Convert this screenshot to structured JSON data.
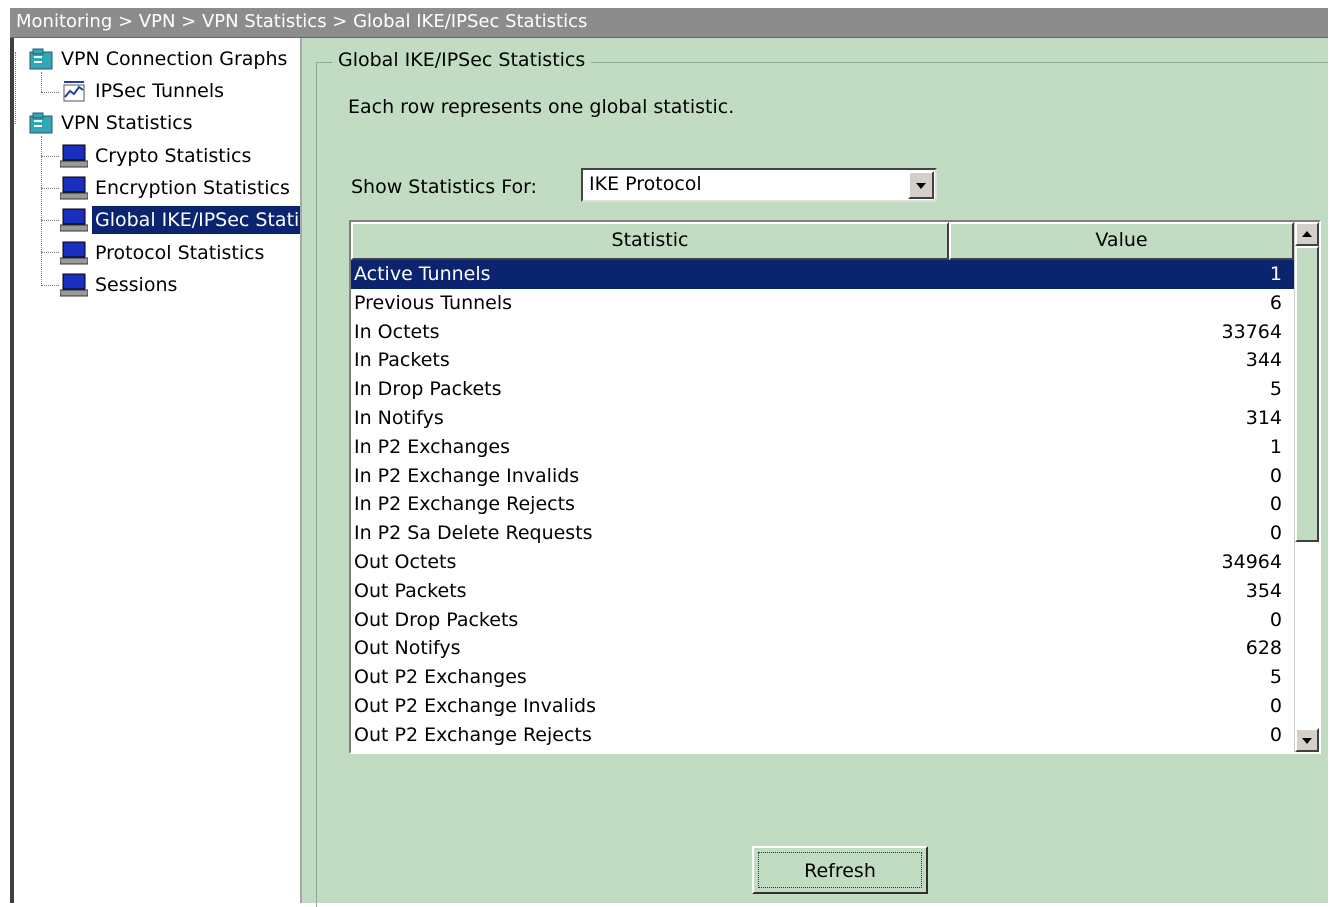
{
  "breadcrumb": "Monitoring > VPN > VPN Statistics >  Global IKE/IPSec Statistics",
  "tree": {
    "items": [
      {
        "label": "VPN Connection Graphs",
        "icon": "folder-db-icon"
      },
      {
        "label": "IPSec Tunnels",
        "icon": "graph-icon"
      },
      {
        "label": "VPN Statistics",
        "icon": "folder-db-icon"
      },
      {
        "label": "Crypto Statistics",
        "icon": "monitor-icon"
      },
      {
        "label": "Encryption Statistics",
        "icon": "monitor-icon"
      },
      {
        "label": "Global IKE/IPSec Statistics",
        "icon": "monitor-icon",
        "selected": true
      },
      {
        "label": "Protocol Statistics",
        "icon": "monitor-icon"
      },
      {
        "label": "Sessions",
        "icon": "monitor-icon"
      }
    ]
  },
  "panel": {
    "title": "Global IKE/IPSec Statistics",
    "description": "Each row represents one global statistic.",
    "show_label": "Show Statistics For:",
    "selected_option": "IKE Protocol",
    "refresh_label": "Refresh"
  },
  "table": {
    "headers": [
      "Statistic",
      "Value"
    ],
    "rows": [
      {
        "statistic": "Active Tunnels",
        "value": "1"
      },
      {
        "statistic": "Previous Tunnels",
        "value": "6"
      },
      {
        "statistic": "In Octets",
        "value": "33764"
      },
      {
        "statistic": "In Packets",
        "value": "344"
      },
      {
        "statistic": "In Drop Packets",
        "value": "5"
      },
      {
        "statistic": "In Notifys",
        "value": "314"
      },
      {
        "statistic": "In P2 Exchanges",
        "value": "1"
      },
      {
        "statistic": "In P2 Exchange Invalids",
        "value": "0"
      },
      {
        "statistic": "In P2 Exchange Rejects",
        "value": "0"
      },
      {
        "statistic": "In P2 Sa Delete Requests",
        "value": "0"
      },
      {
        "statistic": "Out Octets",
        "value": "34964"
      },
      {
        "statistic": "Out Packets",
        "value": "354"
      },
      {
        "statistic": "Out Drop Packets",
        "value": "0"
      },
      {
        "statistic": "Out Notifys",
        "value": "628"
      },
      {
        "statistic": "Out P2 Exchanges",
        "value": "5"
      },
      {
        "statistic": "Out P2 Exchange Invalids",
        "value": "0"
      },
      {
        "statistic": "Out P2 Exchange Rejects",
        "value": "0"
      }
    ]
  },
  "colors": {
    "panel_bg": "#c2dcc3",
    "selection": "#0a2470",
    "breadcrumb_bg": "#8c8c8c"
  }
}
